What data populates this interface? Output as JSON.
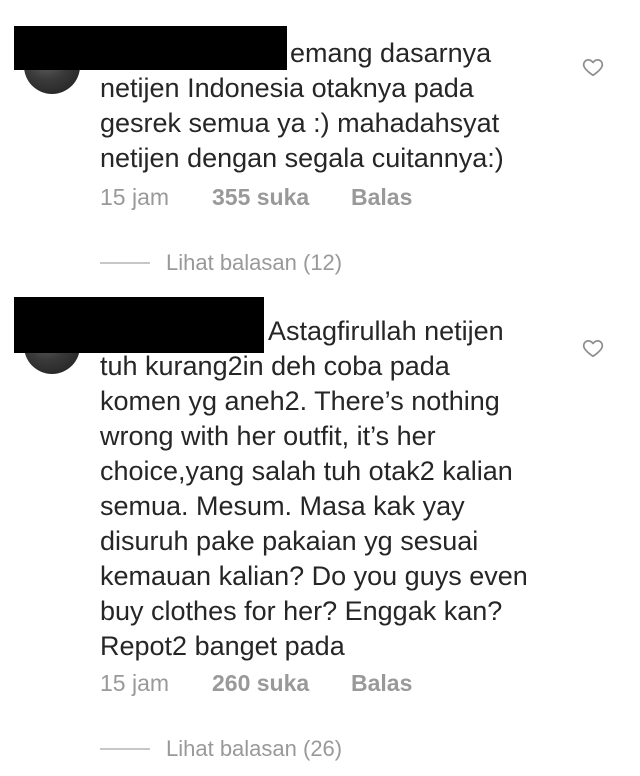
{
  "comments": [
    {
      "lines": [
        "emang dasarnya",
        "netijen Indonesia otaknya pada",
        "gesrek semua ya :) mahadahsyat",
        "netijen dengan segala cuitannya:)"
      ],
      "time": "15 jam",
      "likes": "355 suka",
      "reply": "Balas",
      "view_replies": "Lihat balasan (12)"
    },
    {
      "lines": [
        "Astagfirullah netijen",
        "tuh kurang2in deh coba pada",
        "komen yg aneh2. There’s nothing",
        "wrong with her outfit, it’s her",
        "choice,yang salah tuh otak2 kalian",
        "semua. Mesum. Masa kak yay",
        "disuruh pake pakaian yg sesuai",
        "kemauan kalian? Do you guys even",
        "buy clothes for her? Enggak kan?",
        "Repot2 banget pada"
      ],
      "time": "15 jam",
      "likes": "260 suka",
      "reply": "Balas",
      "view_replies": "Lihat balasan (26)"
    }
  ],
  "icons": {
    "like": "heart-outline-icon",
    "avatar": "avatar"
  },
  "colors": {
    "text": "#262626",
    "muted": "#999999",
    "redaction": "#000000"
  }
}
